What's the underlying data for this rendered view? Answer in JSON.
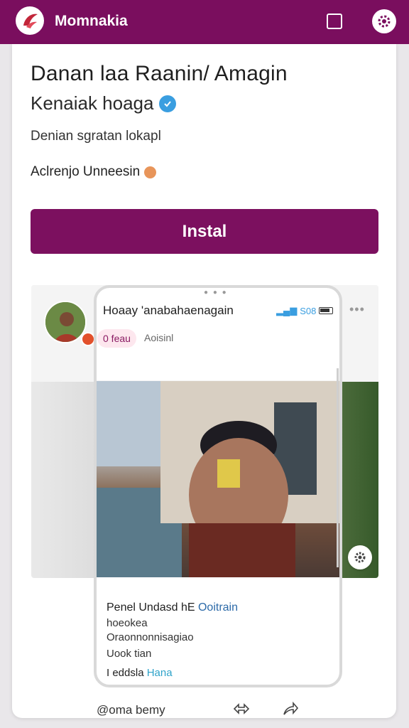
{
  "app_bar": {
    "app_name": "Momnakia",
    "accent_color": "#7a0e5e",
    "icons": [
      "app-logo-icon",
      "square-icon",
      "gear-icon"
    ]
  },
  "listing": {
    "title": "Danan laa Raanin/ Amagin",
    "publisher": "Kenaiak hoaga",
    "description": "Denian sgratan lokapl",
    "meta": "Aclrenjo Unneesin",
    "install_label": "Instal",
    "install_color": "#7c105f"
  },
  "preview": {
    "phone_title": "Hoaay 'anabahaenagain",
    "status_text": "S08",
    "pill_label": "0 feau",
    "pill_sub": "Aoisinl",
    "body": {
      "line1_prefix": "Penel Undasd hE",
      "line1_accent": "Ooitrain",
      "line2": "hoeokea",
      "line3": "Oraonnonnisagiao",
      "line4": "Uook tian",
      "line5_prefix": "I eddsla",
      "line5_accent": "Hana"
    }
  },
  "bottom": {
    "label": "@oma bemy",
    "icons": [
      "swap-icon",
      "share-icon"
    ]
  }
}
